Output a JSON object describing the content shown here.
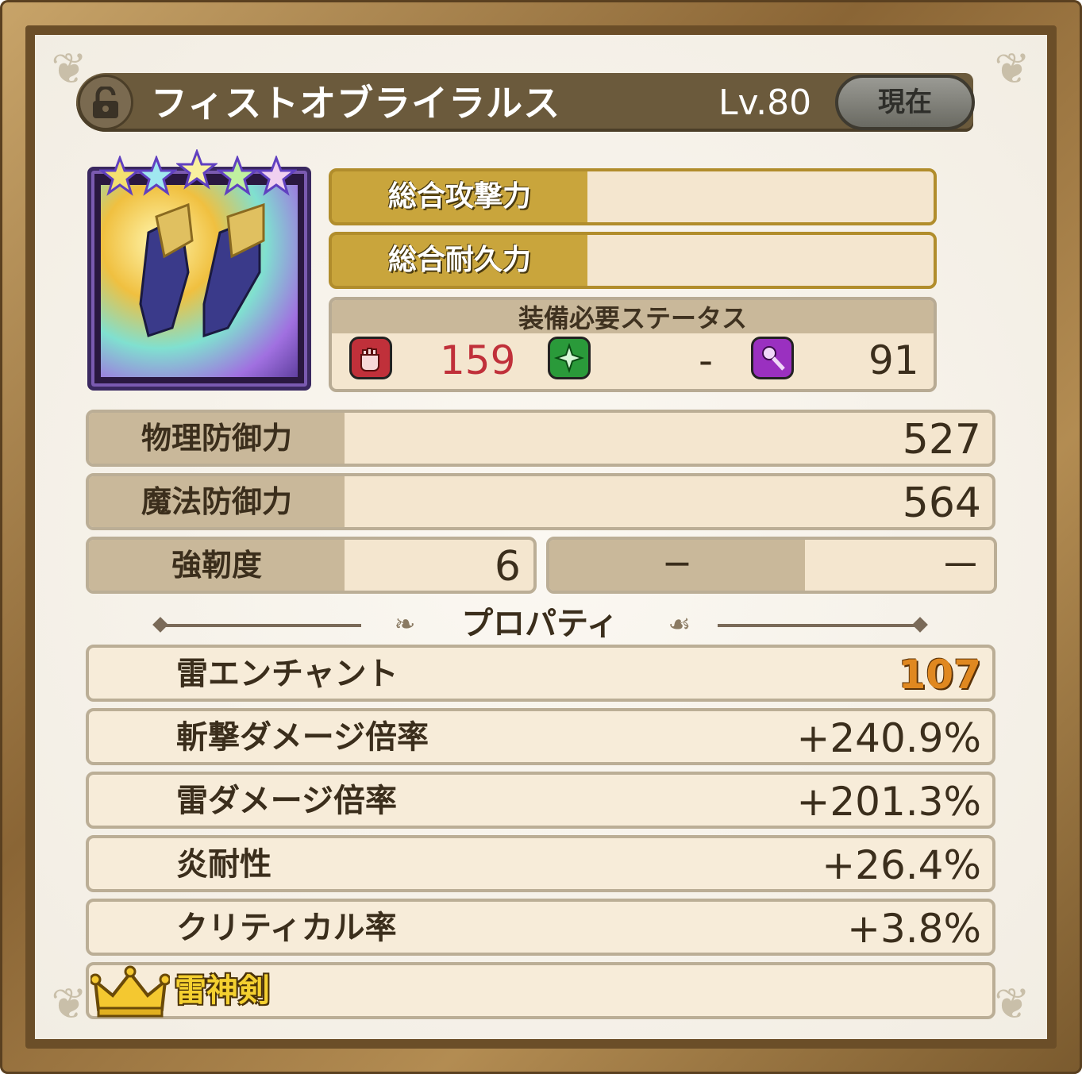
{
  "header": {
    "item_name": "フィストオブライラルス",
    "level": "Lv.80",
    "current_button": "現在"
  },
  "item": {
    "stars": 5,
    "icon": "gauntlets-icon"
  },
  "totals": {
    "attack_label": "総合攻撃力",
    "durability_label": "総合耐久力"
  },
  "requirements": {
    "title": "装備必要ステータス",
    "strength_value": "159",
    "dexterity_value": "-",
    "magic_value": "91",
    "strength_icon": "fist-icon",
    "dexterity_icon": "sparkle-icon",
    "magic_icon": "wand-icon"
  },
  "stats": {
    "phys_def_label": "物理防御力",
    "phys_def_value": "527",
    "mag_def_label": "魔法防御力",
    "mag_def_value": "564",
    "toughness_label": "強靭度",
    "toughness_value": "6",
    "empty_label": "－",
    "empty_value": "－"
  },
  "properties": {
    "title": "プロパティ",
    "items": [
      {
        "label": "雷エンチャント",
        "value": "107"
      },
      {
        "label": "斬撃ダメージ倍率",
        "value": "+240.9%"
      },
      {
        "label": "雷ダメージ倍率",
        "value": "+201.3%"
      },
      {
        "label": "炎耐性",
        "value": "+26.4%"
      },
      {
        "label": "クリティカル率",
        "value": "+3.8%"
      }
    ]
  },
  "set": {
    "name": "雷神剣",
    "icon": "crown-icon"
  },
  "colors": {
    "gold": "#c9a53c",
    "strength_red": "#c0303a",
    "enchant_orange": "#e08820"
  }
}
